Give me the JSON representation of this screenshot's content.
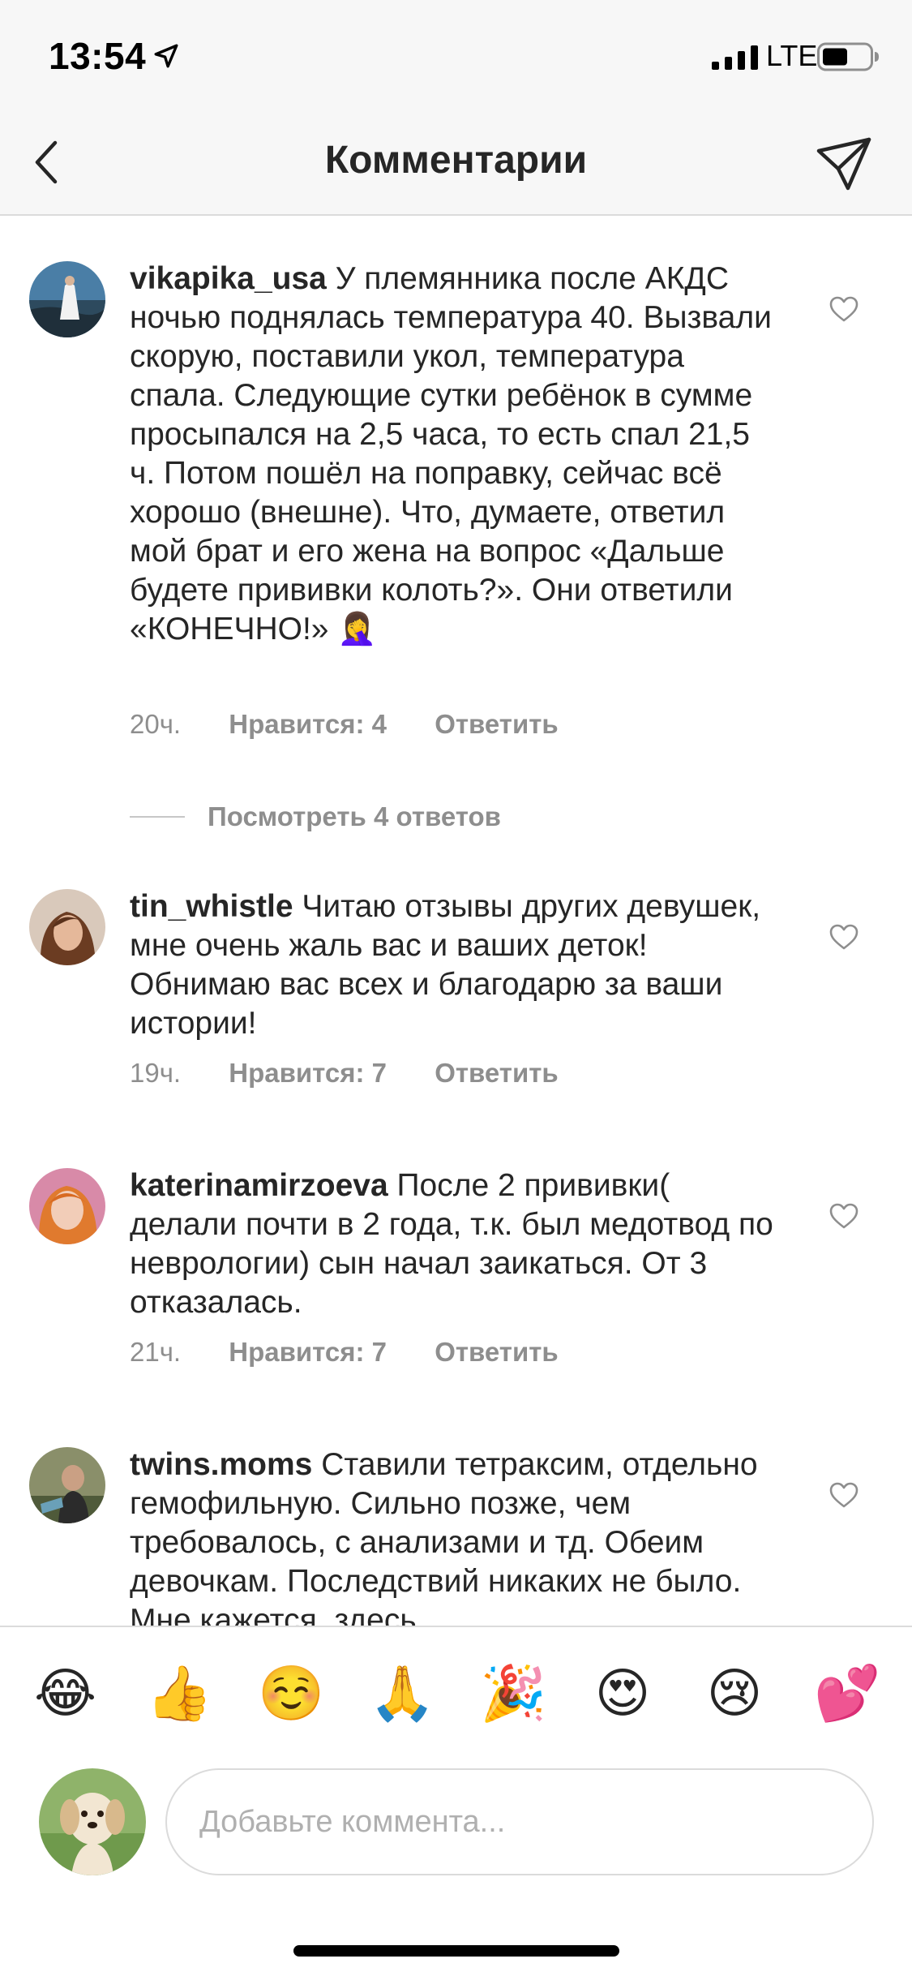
{
  "status_bar": {
    "time": "13:54",
    "network": "LTE",
    "location_icon": "location-arrow-icon",
    "signal_icon": "cell-signal-icon",
    "battery_icon": "battery-icon"
  },
  "header": {
    "title": "Комментарии",
    "back_icon": "chevron-left-icon",
    "send_icon": "paper-plane-icon"
  },
  "comments": [
    {
      "username": "vikapika_usa",
      "text": "У племянника после АКДС ночью поднялась температура 40. Вызвали скорую, поставили укол, температура спала. Следующие сутки ребёнок в сумме просыпался на 2,5 часа, то есть спал 21,5 ч. Потом пошёл на поправку, сейчас всё хорошо (внешне). Что, думаете, ответил мой брат и его жена на вопрос «Дальше будете прививки колоть?». Они ответили «КОНЕЧНО!» 🤦‍♀️",
      "time": "20ч.",
      "likes": "Нравится: 4",
      "reply": "Ответить",
      "view_replies": "Посмотреть 4 ответов"
    },
    {
      "username": "tin_whistle",
      "text": "Читаю отзывы других девушек, мне очень жаль вас и ваших деток! Обнимаю вас всех и благодарю за ваши истории!",
      "time": "19ч.",
      "likes": "Нравится: 7",
      "reply": "Ответить"
    },
    {
      "username": "katerinamirzoeva",
      "text": "После 2 прививки( делали почти в 2 года, т.к. был медотвод по неврологии) сын начал заикаться. От 3 отказалась.",
      "time": "21ч.",
      "likes": "Нравится: 7",
      "reply": "Ответить"
    },
    {
      "username": "twins.moms",
      "text": "Ставили тетраксим, отдельно гемофильную. Сильно позже, чем требовалось, с анализами и тд. Обеим девочкам. Последствий никаких не было. Мне кажется, здесь"
    }
  ],
  "heart_icon": "heart-outline-icon",
  "emoji_bar": [
    "😂",
    "👍",
    "☺️",
    "🙏",
    "🎉",
    "😍",
    "😢",
    "💕"
  ],
  "compose": {
    "placeholder": "Добавьте коммента..."
  },
  "colors": {
    "header_bg": "#f7f7f7",
    "text": "#262626",
    "secondary": "#8e8e8e",
    "border": "#dbdbdb"
  }
}
